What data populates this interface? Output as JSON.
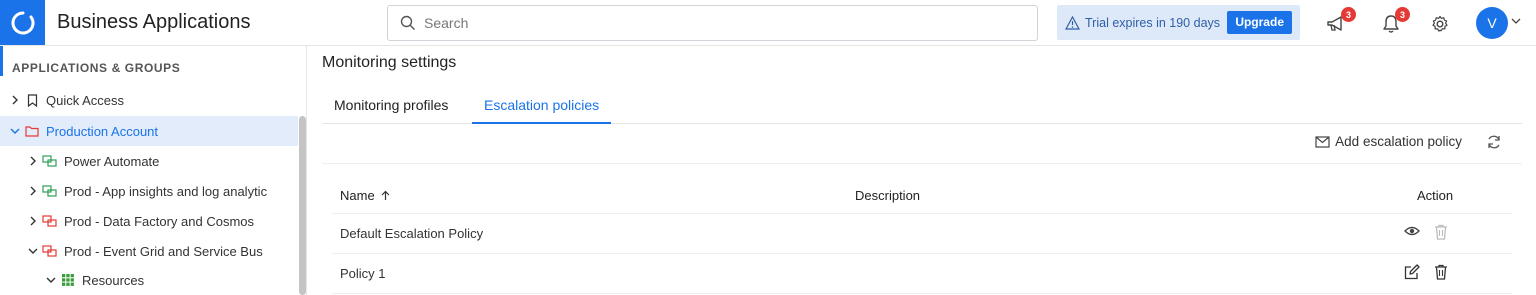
{
  "header": {
    "app_title": "Business Applications",
    "search_placeholder": "Search",
    "trial_text": "Trial expires in 190 days",
    "upgrade_label": "Upgrade",
    "announcements_count": "3",
    "notifications_count": "3",
    "avatar_initial": "V"
  },
  "sidebar": {
    "heading": "APPLICATIONS & GROUPS",
    "items": [
      {
        "label": "Quick Access",
        "icon": "bookmark-icon"
      },
      {
        "label": "Production Account",
        "icon": "folder-icon",
        "selected": true
      },
      {
        "label": "Power Automate",
        "icon": "group-icon-green"
      },
      {
        "label": "Prod - App insights and log analytic",
        "icon": "group-icon-green"
      },
      {
        "label": "Prod - Data Factory and Cosmos",
        "icon": "group-icon-red"
      },
      {
        "label": "Prod - Event Grid and Service Bus",
        "icon": "group-icon-red"
      },
      {
        "label": "Resources",
        "icon": "grid-icon"
      }
    ]
  },
  "main": {
    "title": "Monitoring settings",
    "tabs": [
      {
        "label": "Monitoring profiles"
      },
      {
        "label": "Escalation policies",
        "active": true
      }
    ],
    "add_label": "Add escalation policy",
    "table": {
      "columns": [
        "Name",
        "Description",
        "Action"
      ],
      "rows": [
        {
          "name": "Default Escalation Policy",
          "description": "",
          "actions": [
            "view-icon",
            "delete-icon"
          ]
        },
        {
          "name": "Policy 1",
          "description": "",
          "actions": [
            "edit-icon",
            "delete-icon"
          ]
        }
      ]
    }
  },
  "colors": {
    "accent": "#1a73e8",
    "badge": "#e53935",
    "selected_bg": "#e2ecfb",
    "trial_bg": "#dde9f8"
  }
}
